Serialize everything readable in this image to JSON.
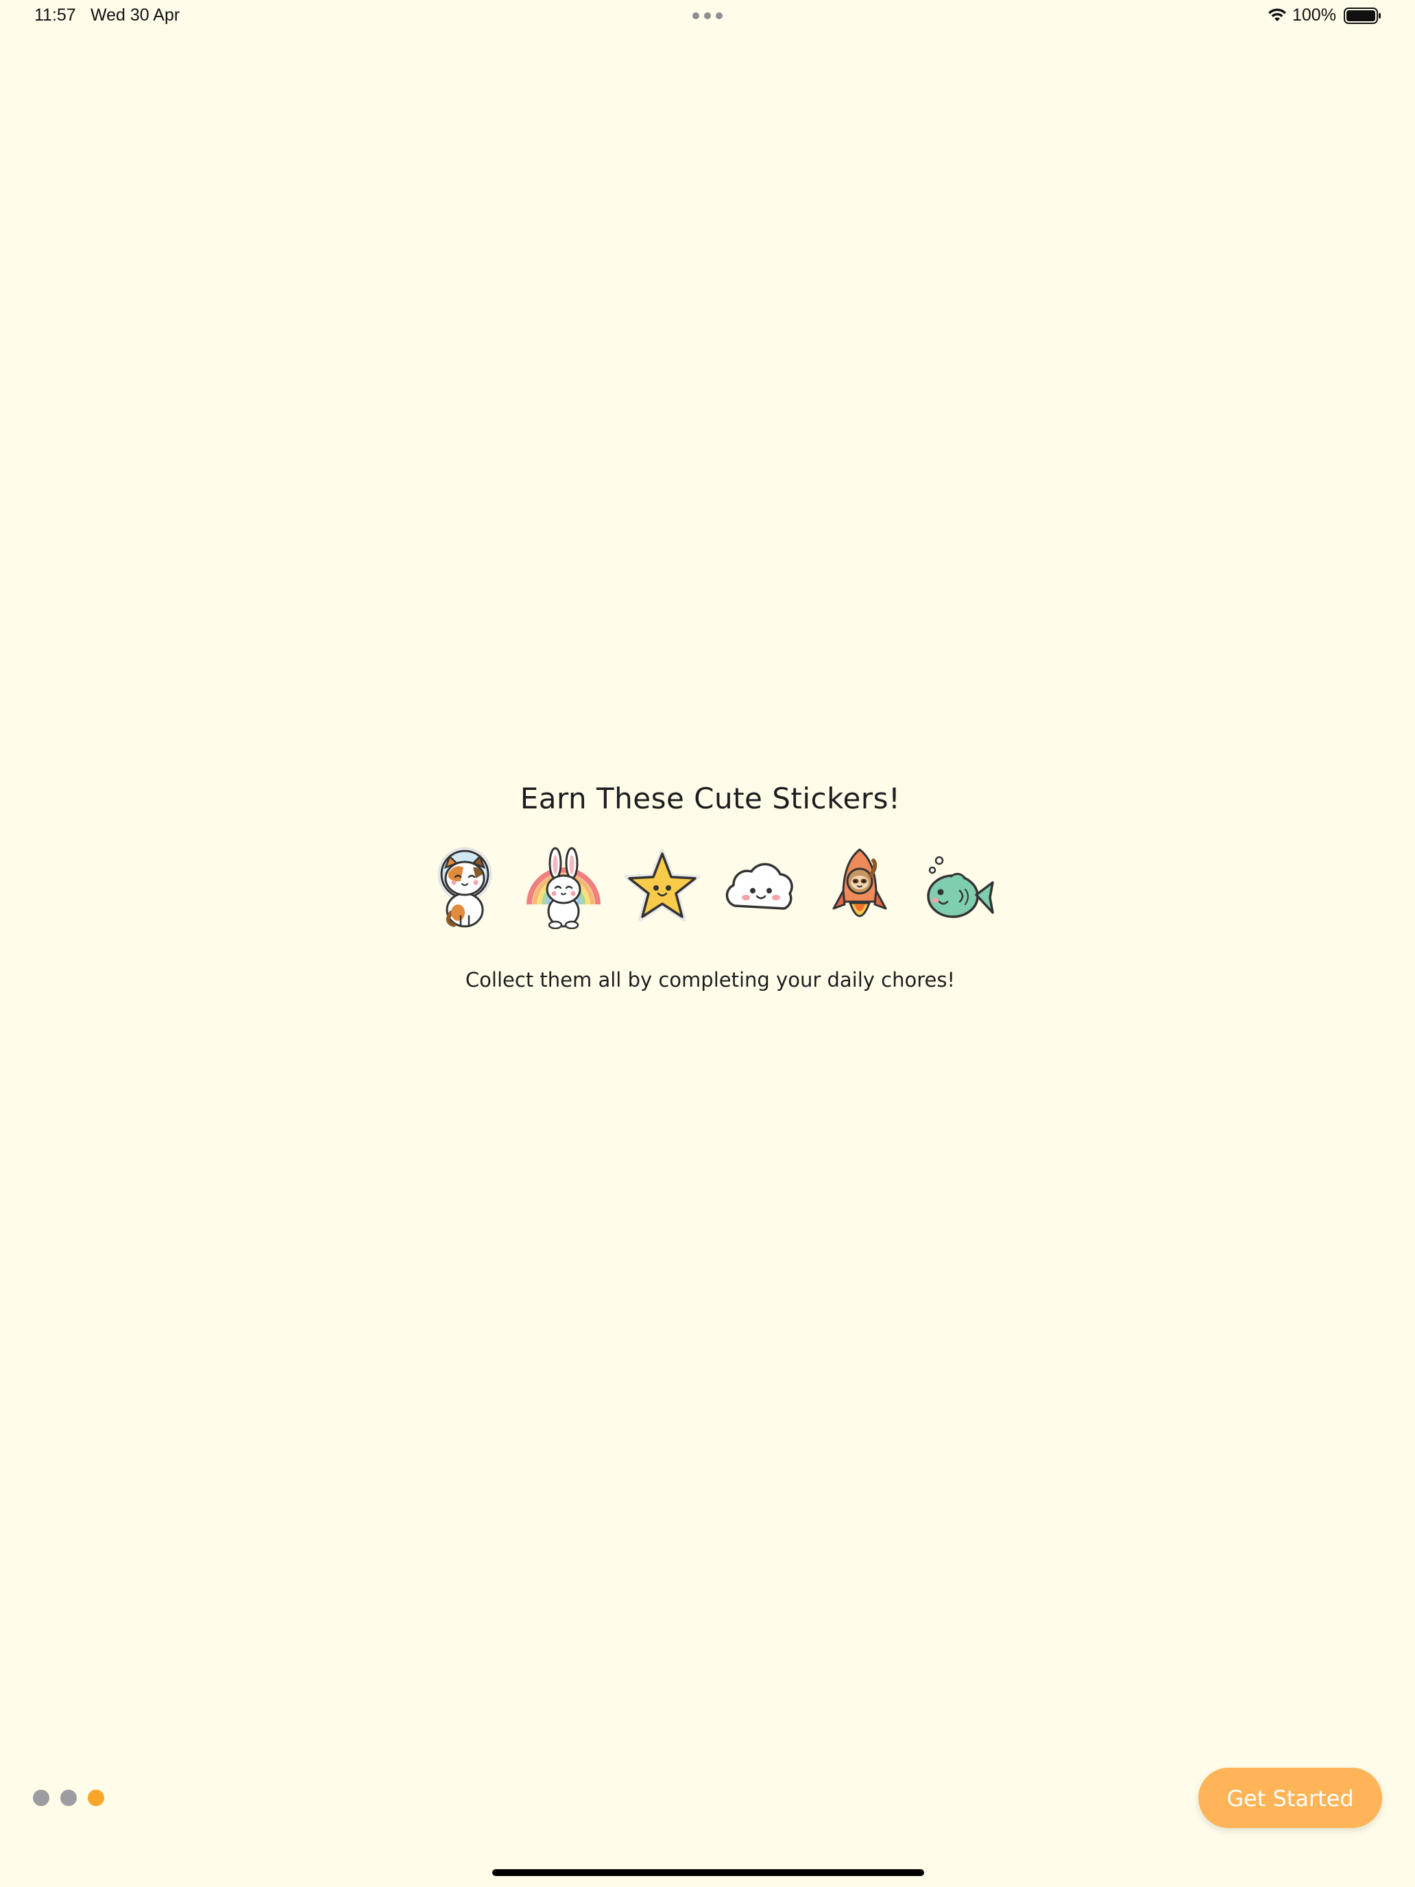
{
  "status_bar": {
    "time": "11:57",
    "date": "Wed 30 Apr",
    "battery_percent": "100%"
  },
  "main": {
    "title": "Earn These Cute Stickers!",
    "subtitle": "Collect them all by completing your daily chores!",
    "stickers": [
      {
        "icon": "astronaut-cat-sticker-icon"
      },
      {
        "icon": "rainbow-bunny-sticker-icon"
      },
      {
        "icon": "smiling-star-sticker-icon"
      },
      {
        "icon": "happy-cloud-sticker-icon"
      },
      {
        "icon": "sloth-rocket-sticker-icon"
      },
      {
        "icon": "green-fish-sticker-icon"
      }
    ]
  },
  "footer": {
    "pages_total": 3,
    "active_page": 3,
    "button_label": "Get Started"
  },
  "colors": {
    "background": "#fffde9",
    "accent": "#ffb457",
    "active_dot": "#f7a62a",
    "inactive_dot": "#9c9ca1"
  }
}
